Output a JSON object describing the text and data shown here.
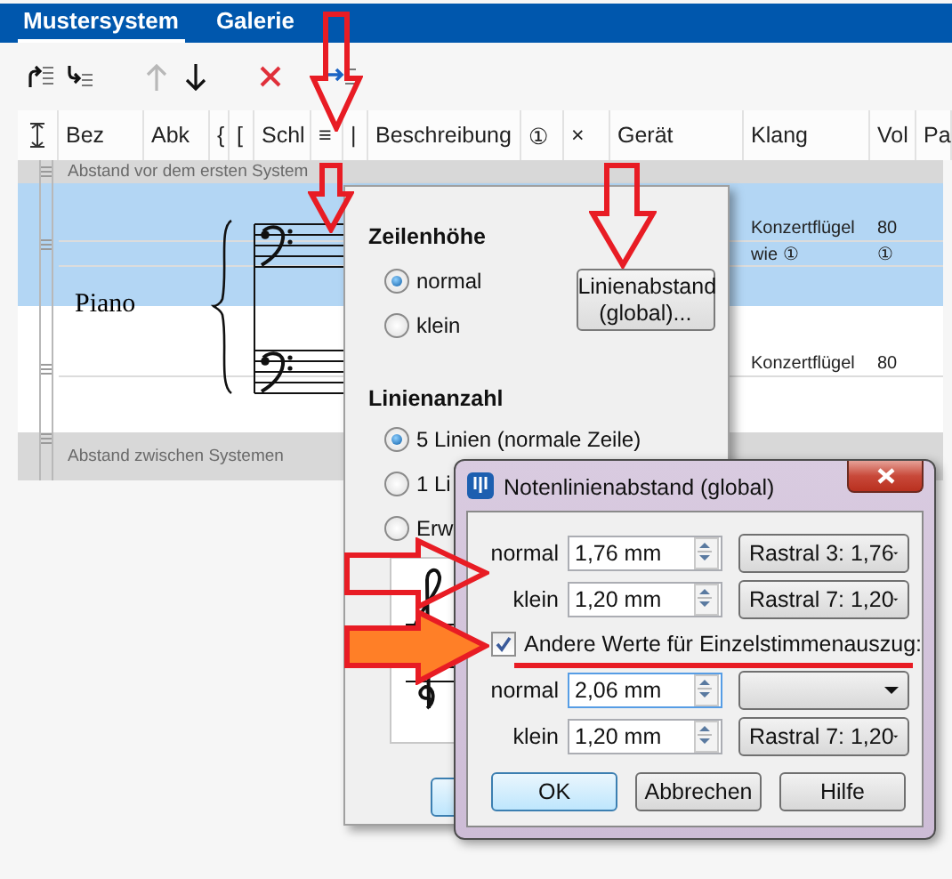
{
  "tabs": [
    {
      "label": "Mustersystem",
      "selected": true
    },
    {
      "label": "Galerie",
      "selected": false
    }
  ],
  "toolbar": [
    {
      "kind": "insert-above",
      "disabled": false
    },
    {
      "kind": "insert-below",
      "disabled": false
    },
    {
      "kind": "move-up",
      "disabled": true
    },
    {
      "kind": "move-down",
      "disabled": false
    },
    {
      "kind": "delete",
      "disabled": false
    },
    {
      "kind": "add",
      "disabled": false
    }
  ],
  "columns": [
    "Bez",
    "Abk",
    "{",
    "[",
    "Schl",
    "≡",
    "|",
    "Beschreibung",
    "①",
    "×",
    "Gerät",
    "Klang",
    "Vol",
    "Pa"
  ],
  "spacer_before": "Abstand vor dem ersten System",
  "instrument": {
    "name": "Piano",
    "staves": [
      {
        "selected": true,
        "details": [
          {
            "sound": "Konzertflügel",
            "volume": "80"
          },
          {
            "sound": "wie ①",
            "volume": "①"
          }
        ]
      },
      {
        "selected": false,
        "details": [
          {
            "sound": "Konzertflügel",
            "volume": "80"
          }
        ]
      }
    ]
  },
  "spacer_between": "Abstand zwischen Systemen",
  "staff_popup": {
    "row_height": {
      "title": "Zeilenhöhe",
      "options": [
        {
          "label": "normal",
          "selected": true
        },
        {
          "label": "klein",
          "selected": false
        }
      ]
    },
    "spacing_button": "Linienabstand (global)...",
    "line_count": {
      "title": "Linienanzahl",
      "options": [
        {
          "label": "5 Linien (normale Zeile)",
          "selected": true
        },
        {
          "label": "1 Li",
          "selected": false
        },
        {
          "label": "Erw",
          "selected": false
        }
      ]
    }
  },
  "dialog": {
    "title": "Notenlinienabstand (global)",
    "rows": [
      {
        "label": "normal",
        "value": "1,76 mm",
        "preset": "Rastral 3: 1,76",
        "focused": false
      },
      {
        "label": "klein",
        "value": "1,20 mm",
        "preset": "Rastral 7: 1,20",
        "focused": false
      }
    ],
    "checkbox": {
      "label": "Andere Werte für Einzelstimmenauszug:",
      "checked": true
    },
    "part_rows": [
      {
        "label": "normal",
        "value": "2,06 mm",
        "focused": true
      },
      {
        "label": "klein",
        "value": "1,20 mm",
        "preset": "Rastral 7: 1,20",
        "focused": false
      }
    ],
    "buttons": [
      {
        "label": "OK",
        "default": true
      },
      {
        "label": "Abbrechen",
        "default": false
      },
      {
        "label": "Hilfe",
        "default": false
      }
    ]
  }
}
